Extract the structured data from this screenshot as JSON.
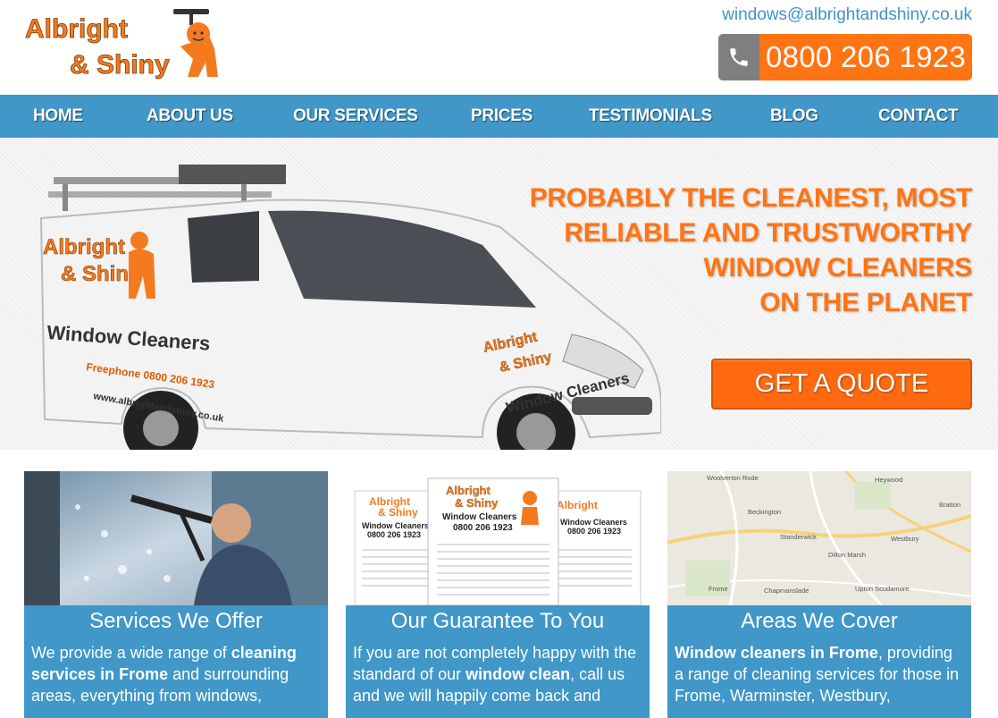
{
  "brand": {
    "logo_line1": "Albright",
    "logo_line2": "& Shiny",
    "email": "windows@albrightandshiny.co.uk",
    "phone": "0800 206 1923",
    "phone_icon": "phone-icon"
  },
  "nav": {
    "items": [
      {
        "label": "HOME"
      },
      {
        "label": "ABOUT US"
      },
      {
        "label": "OUR SERVICES"
      },
      {
        "label": "PRICES"
      },
      {
        "label": "TESTIMONIALS"
      },
      {
        "label": "BLOG"
      },
      {
        "label": "CONTACT"
      }
    ]
  },
  "hero": {
    "tagline": [
      "PROBABLY THE CLEANEST, MOST",
      "RELIABLE AND TRUSTWORTHY",
      "WINDOW CLEANERS",
      "ON THE PLANET"
    ],
    "quote_button": "GET A QUOTE",
    "van_text": {
      "logo1": "Albright",
      "logo2": "& Shiny",
      "window_cleaners": "Window Cleaners",
      "freephone": "Freephone 0800 206 1923",
      "website": "www.albrightandshiny.co.uk"
    }
  },
  "flyer": {
    "logo1": "Albright",
    "logo2": "& Shiny",
    "title": "Window Cleaners",
    "phone": "0800 206 1923"
  },
  "map": {
    "places": [
      "Woolverton Rode",
      "Heywood",
      "Beckington",
      "Standerwick",
      "Westbury",
      "Dilton Marsh",
      "Frome",
      "Chapmanslade",
      "Upton Scudamore",
      "Bratton"
    ]
  },
  "cards": [
    {
      "title": "Services We Offer",
      "text_parts": [
        {
          "t": "We provide a wide range of ",
          "b": false
        },
        {
          "t": "cleaning services in Frome",
          "b": true
        },
        {
          "t": " and surrounding areas, everything from windows,",
          "b": false
        }
      ]
    },
    {
      "title": "Our Guarantee To You",
      "text_parts": [
        {
          "t": "If you are not completely happy with the standard of our ",
          "b": false
        },
        {
          "t": "window clean",
          "b": true
        },
        {
          "t": ", call us and we will happily come back and",
          "b": false
        }
      ]
    },
    {
      "title": "Areas We Cover",
      "text_parts": [
        {
          "t": "Window cleaners in Frome",
          "b": true
        },
        {
          "t": ", providing a range of cleaning services for those in Frome, Warminster, Westbury,",
          "b": false
        }
      ]
    }
  ],
  "colors": {
    "accent_orange": "#ff7413",
    "nav_blue": "#4097c8",
    "grey": "#7f7f7f"
  }
}
